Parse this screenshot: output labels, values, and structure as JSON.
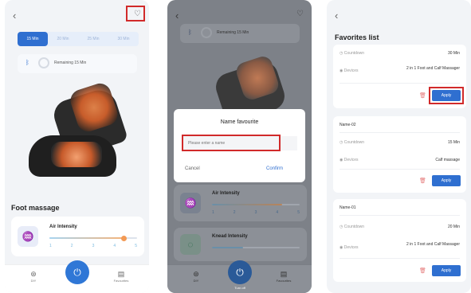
{
  "screen1": {
    "time_tabs": [
      "15 Min",
      "20 Min",
      "25 Min",
      "30 Min"
    ],
    "selected_tab": 0,
    "remaining": "Remaining 15 Min",
    "section_title": "Foot massage",
    "air_intensity": {
      "label": "Air Intensity",
      "level_percent": 85,
      "ticks": [
        "1",
        "2",
        "3",
        "4",
        "5"
      ]
    },
    "tabs": {
      "left": "DIY",
      "center": "Turn off",
      "right": "Favourites"
    }
  },
  "screen2": {
    "remaining": "Remaining 15 Min",
    "dialog": {
      "title": "Name favourite",
      "placeholder": "Please enter a name",
      "cancel": "Cancel",
      "confirm": "Confirm"
    },
    "air_intensity": {
      "label": "Air Intensity",
      "ticks": [
        "1",
        "2",
        "3",
        "4",
        "5"
      ]
    },
    "knead_intensity": {
      "label": "Knead Intensity"
    },
    "tabs": {
      "left": "DIY",
      "center": "Turn off",
      "right": "Favourites"
    }
  },
  "screen3": {
    "title": "Favorites list",
    "items": [
      {
        "name": "",
        "countdown_label": "Countdown",
        "countdown": "30 Min",
        "devices_label": "Devices",
        "devices": "2 in 1 Foot and Calf Massager",
        "apply": "Apply"
      },
      {
        "name": "Name-02",
        "countdown_label": "Countdown",
        "countdown": "15 Min",
        "devices_label": "Devices",
        "devices": "Calf massage",
        "apply": "Apply"
      },
      {
        "name": "Name-01",
        "countdown_label": "Countdown",
        "countdown": "20 Min",
        "devices_label": "Devices",
        "devices": "2 in 1 Foot and Calf Massager",
        "apply": "Apply"
      }
    ]
  },
  "colors": {
    "accent": "#2f6fd0",
    "highlight": "#d12a2a",
    "warm": "#f39a55"
  }
}
